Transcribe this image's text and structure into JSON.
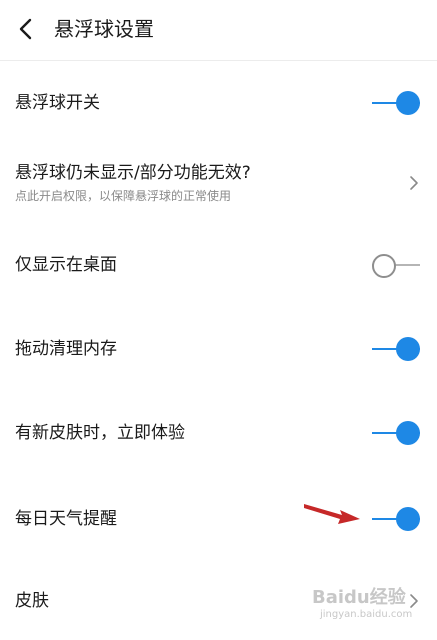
{
  "header": {
    "title": "悬浮球设置",
    "back_icon": "chevron-left-icon"
  },
  "settings": [
    {
      "label": "悬浮球开关",
      "control": "toggle",
      "on": true
    },
    {
      "label": "悬浮球仍未显示/部分功能无效?",
      "sublabel": "点此开启权限，以保障悬浮球的正常使用",
      "control": "chevron"
    },
    {
      "label": "仅显示在桌面",
      "control": "toggle",
      "on": false
    },
    {
      "label": "拖动清理内存",
      "control": "toggle",
      "on": true
    },
    {
      "label": "有新皮肤时，立即体验",
      "control": "toggle",
      "on": true
    },
    {
      "label": "每日天气提醒",
      "control": "toggle",
      "on": true
    },
    {
      "label": "皮肤",
      "control": "chevron"
    }
  ],
  "annotation": {
    "icon": "red-arrow-icon",
    "color": "#c62828"
  },
  "watermark": {
    "logo": "Baidu经验",
    "url": "jingyan.baidu.com"
  },
  "colors": {
    "accent": "#1e88e5",
    "text": "#1a1a1a",
    "subtext": "#8a8a8a"
  }
}
